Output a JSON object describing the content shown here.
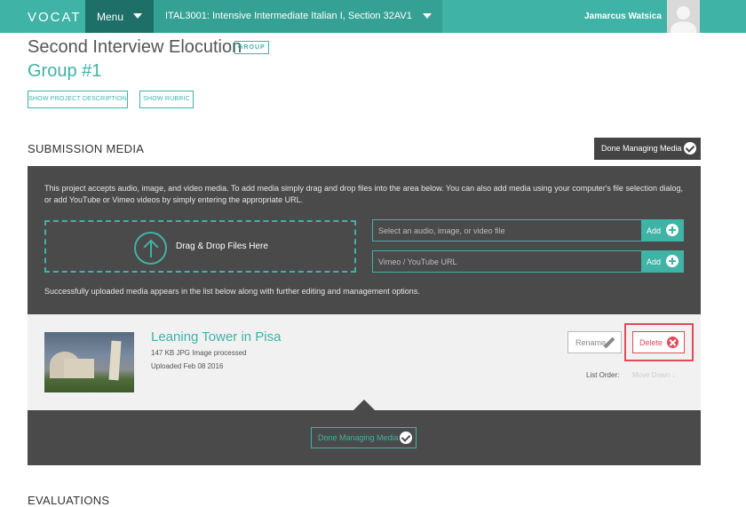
{
  "nav": {
    "logo": "VOCAT",
    "menu_label": "Menu",
    "course_label": "ITAL3001: Intensive Intermediate Italian I, Section 32AV1",
    "user_name": "Jamarcus Watsica"
  },
  "header": {
    "title": "Second Interview Elocution",
    "badge": "GROUP",
    "group_name": "Group #1",
    "show_description_label": "SHOW PROJECT DESCRIPTION",
    "show_rubric_label": "SHOW RUBRIC"
  },
  "submission": {
    "heading": "SUBMISSION MEDIA",
    "done_label": "Done Managing Media",
    "intro_text": "This project accepts audio, image, and video media. To add media simply drag and drop files into the area below. You can also add media using your computer's file selection dialog, or add YouTube or Vimeo videos by simply entering the appropriate URL.",
    "drop_label": "Drag & Drop Files Here",
    "file_placeholder": "Select an audio, image, or video file",
    "url_placeholder": "Vimeo / YouTube URL",
    "add_label": "Add",
    "success_text": "Successfully uploaded media appears in the list below along with further editing and management options."
  },
  "media_item": {
    "title": "Leaning Tower in Pisa",
    "meta": "147 KB JPG Image processed",
    "uploaded": "Uploaded Feb 08 2016",
    "rename_label": "Rename",
    "delete_label": "Delete",
    "list_order_label": "List Order:",
    "move_down_label": "Move Down ↓"
  },
  "footer_panel": {
    "done_label": "Done Managing Media"
  },
  "evaluations": {
    "heading": "EVALUATIONS"
  },
  "colors": {
    "brand": "#3fb3a5",
    "menu_dark": "#1e6f68",
    "panel_dark": "#4a4a4a",
    "danger": "#e34a5a"
  },
  "icons": [
    "caret-down-icon",
    "avatar-icon",
    "upload-arrow-icon",
    "plus-icon",
    "check-icon",
    "pencil-icon",
    "close-icon"
  ]
}
